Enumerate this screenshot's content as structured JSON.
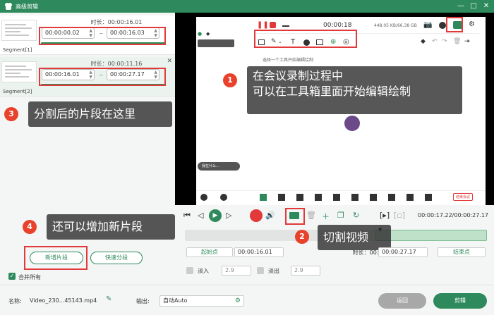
{
  "window": {
    "title": "高级剪辑"
  },
  "segments": [
    {
      "label": "Segment[1]",
      "duration": "时长：00:00:16.01",
      "start": "00:00:00.02",
      "end": "00:00:16.03"
    },
    {
      "label": "Segment[2]",
      "duration": "时长：00:00:11.16",
      "start": "00:00:16.01",
      "end": "00:00:27.17"
    }
  ],
  "recorder": {
    "timer": "00:00:18",
    "storage": "448.05 KB/66.38 GB",
    "hint": "选择一个工具开始编辑绘制",
    "small_text": "我在什么...",
    "end_meeting": "结束会议"
  },
  "annotations": [
    {
      "num": "1",
      "text": [
        "在会议录制过程中",
        "可以在工具箱里面开始编辑绘制"
      ]
    },
    {
      "num": "2",
      "text": [
        "切割视频"
      ]
    },
    {
      "num": "3",
      "text": [
        "分割后的片段在这里"
      ]
    },
    {
      "num": "4",
      "text": [
        "还可以增加新片段"
      ]
    }
  ],
  "player": {
    "time": "00:00:17.22/00:00:27.17"
  },
  "edit": {
    "start_label": "起始点",
    "start_value": "00:00:16.01",
    "duration_label": "时长：00:00:11.16",
    "end_value": "00:00:27.17",
    "end_label": "结束点",
    "fade_in_label": "淡入",
    "fade_in_value": "2.9",
    "fade_out_label": "淡出",
    "fade_out_value": "2.9"
  },
  "left_actions": {
    "new_segment": "新增片段",
    "quick_split": "快速分段",
    "merge_all": "合并所有"
  },
  "footer": {
    "name_label": "名称:",
    "name_value": "Video_230...45143.mp4",
    "output_label": "输出:",
    "output_value": "自动Auto",
    "back": "返回",
    "edit": "剪辑"
  },
  "colors": {
    "brand": "#2e8a5c",
    "annotation_red": "#e23a3a",
    "badge": "#e8412c"
  }
}
